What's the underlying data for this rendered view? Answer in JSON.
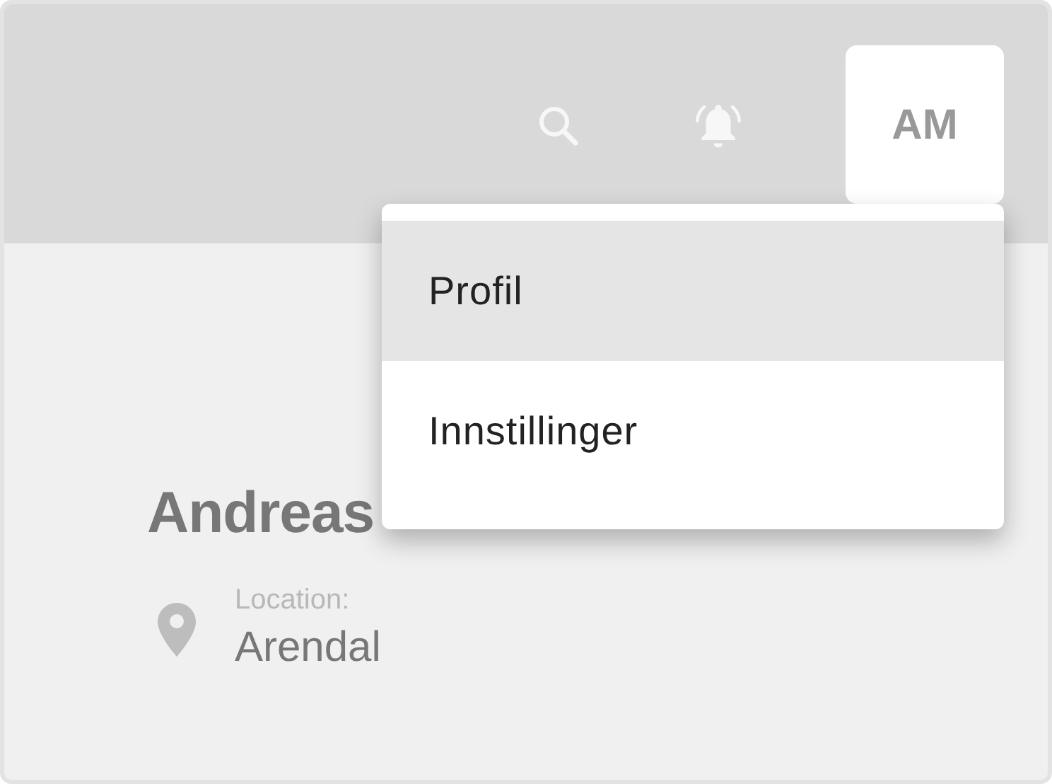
{
  "header": {
    "avatar": {
      "initials": "AM"
    }
  },
  "menu": {
    "items": [
      {
        "label": "Profil",
        "selected": true
      },
      {
        "label": "Innstillinger",
        "selected": false
      }
    ]
  },
  "profile": {
    "name": "Andreas",
    "location_label": "Location:",
    "location": "Arendal"
  }
}
